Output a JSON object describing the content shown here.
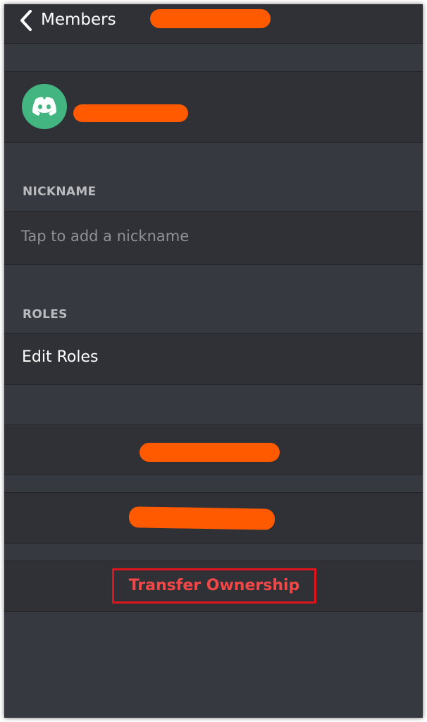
{
  "header": {
    "back_label": "Members"
  },
  "sections": {
    "nickname_header": "NICKNAME",
    "nickname_placeholder": "Tap to add a nickname",
    "roles_header": "ROLES",
    "edit_roles_label": "Edit Roles"
  },
  "actions": {
    "transfer_ownership_label": "Transfer Ownership"
  },
  "colors": {
    "background": "#363940",
    "bar": "#2f3136",
    "avatar": "#43b581",
    "redaction": "#ff5a00",
    "danger_text": "#f04747",
    "highlight_box": "#e0151c"
  },
  "icons": {
    "back": "chevron-left-icon",
    "avatar": "discord-logo-icon"
  }
}
